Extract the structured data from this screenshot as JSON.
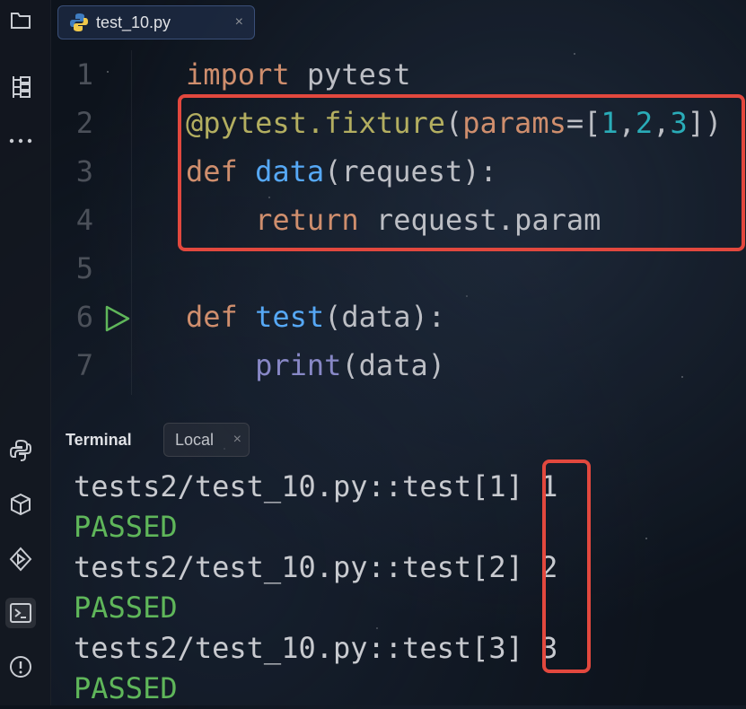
{
  "tab": {
    "label": "test_10.py",
    "close": "×"
  },
  "sidebar": {
    "icons": [
      "folder-icon",
      "structure-icon",
      "more-icon",
      "python-console-icon",
      "python-packages-icon",
      "services-icon",
      "terminal-icon",
      "problems-icon"
    ]
  },
  "editor": {
    "lines": [
      {
        "num": "1",
        "tokens": [
          [
            "kw",
            "import"
          ],
          [
            "plain",
            " pytest"
          ]
        ]
      },
      {
        "num": "2",
        "tokens": [
          [
            "dec",
            "@pytest.fixture"
          ],
          [
            "plain",
            "("
          ],
          [
            "param",
            "params"
          ],
          [
            "plain",
            "=["
          ],
          [
            "num",
            "1"
          ],
          [
            "plain",
            ","
          ],
          [
            "num",
            "2"
          ],
          [
            "plain",
            ","
          ],
          [
            "num",
            "3"
          ],
          [
            "plain",
            "])"
          ]
        ]
      },
      {
        "num": "3",
        "tokens": [
          [
            "kw",
            "def "
          ],
          [
            "fn",
            "data"
          ],
          [
            "plain",
            "(request):"
          ]
        ]
      },
      {
        "num": "4",
        "tokens": [
          [
            "plain",
            "    "
          ],
          [
            "kw",
            "return"
          ],
          [
            "plain",
            " request.param"
          ]
        ]
      },
      {
        "num": "5",
        "tokens": []
      },
      {
        "num": "6",
        "tokens": [
          [
            "kw",
            "def "
          ],
          [
            "fn",
            "test"
          ],
          [
            "plain",
            "(data):"
          ]
        ]
      },
      {
        "num": "7",
        "tokens": [
          [
            "plain",
            "    "
          ],
          [
            "builtin",
            "print"
          ],
          [
            "plain",
            "(data)"
          ]
        ]
      }
    ]
  },
  "terminal": {
    "title": "Terminal",
    "tab_label": "Local",
    "tab_close": "×",
    "output": [
      {
        "text": "tests2/test_10.py::test[1] 1",
        "kind": "out"
      },
      {
        "text": "PASSED",
        "kind": "pass"
      },
      {
        "text": "tests2/test_10.py::test[2] 2",
        "kind": "out"
      },
      {
        "text": "PASSED",
        "kind": "pass"
      },
      {
        "text": "tests2/test_10.py::test[3] 3",
        "kind": "out"
      },
      {
        "text": "PASSED",
        "kind": "pass"
      }
    ]
  },
  "colors": {
    "highlight": "#e2483e",
    "keyword": "#cf8e6d",
    "decorator": "#b3ae60",
    "function": "#56a8f5",
    "number": "#2aacb8",
    "builtin": "#8888c6",
    "passed": "#5fb65a"
  }
}
